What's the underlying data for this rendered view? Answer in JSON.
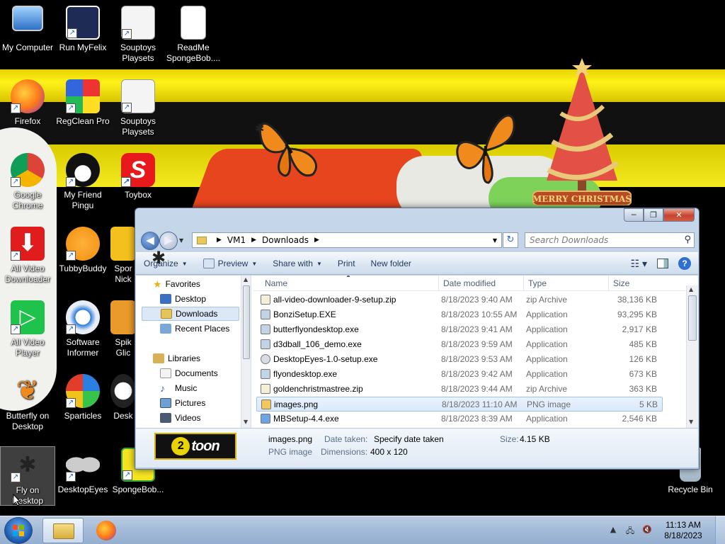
{
  "desktop": {
    "icons": [
      {
        "label": "My Computer"
      },
      {
        "label": "Run MyFelix"
      },
      {
        "label": "Souptoys Playsets"
      },
      {
        "label": "ReadMe SpongeBob...."
      },
      {
        "label": "Firefox"
      },
      {
        "label": "RegClean Pro"
      },
      {
        "label": "Souptoys Playsets"
      },
      {
        "label": "Google Chrome"
      },
      {
        "label": "My Friend Pingu"
      },
      {
        "label": "Toybox"
      },
      {
        "label": "All Video Downloader"
      },
      {
        "label": "TubbyBuddy"
      },
      {
        "label": "Spor Nick"
      },
      {
        "label": "All Video Player"
      },
      {
        "label": "Software Informer"
      },
      {
        "label": "Spik Glic"
      },
      {
        "label": "Butterfly on Desktop"
      },
      {
        "label": "Sparticles"
      },
      {
        "label": "Desk"
      },
      {
        "label": "Fly on Desktop"
      },
      {
        "label": "DesktopEyes"
      },
      {
        "label": "SpongeBob..."
      },
      {
        "label": "Recycle Bin"
      }
    ],
    "tree_banner": "MERRY CHRISTMAS"
  },
  "explorer": {
    "caption": {
      "minimize": "─",
      "maximize": "❐",
      "close": "✕"
    },
    "address": {
      "root": "VM1",
      "folder": "Downloads",
      "sep": "▶"
    },
    "search_placeholder": "Search Downloads",
    "commands": {
      "organize": "Organize",
      "preview": "Preview",
      "share": "Share with",
      "print": "Print",
      "new_folder": "New folder"
    },
    "nav": {
      "favorites": "Favorites",
      "desktop": "Desktop",
      "downloads": "Downloads",
      "recent": "Recent Places",
      "libraries": "Libraries",
      "documents": "Documents",
      "music": "Music",
      "pictures": "Pictures",
      "videos": "Videos"
    },
    "columns": {
      "name": "Name",
      "date": "Date modified",
      "type": "Type",
      "size": "Size"
    },
    "files": [
      {
        "name": "all-video-downloader-9-setup.zip",
        "date": "8/18/2023 9:40 AM",
        "type": "zip Archive",
        "size": "38,136 KB"
      },
      {
        "name": "BonziSetup.EXE",
        "date": "8/18/2023 10:55 AM",
        "type": "Application",
        "size": "93,295 KB"
      },
      {
        "name": "butterflyondesktop.exe",
        "date": "8/18/2023 9:41 AM",
        "type": "Application",
        "size": "2,917 KB"
      },
      {
        "name": "d3dball_106_demo.exe",
        "date": "8/18/2023 9:59 AM",
        "type": "Application",
        "size": "485 KB"
      },
      {
        "name": "DesktopEyes-1.0-setup.exe",
        "date": "8/18/2023 9:53 AM",
        "type": "Application",
        "size": "126 KB"
      },
      {
        "name": "flyondesktop.exe",
        "date": "8/18/2023 9:42 AM",
        "type": "Application",
        "size": "673 KB"
      },
      {
        "name": "goldenchristmastree.zip",
        "date": "8/18/2023 9:44 AM",
        "type": "zip Archive",
        "size": "363 KB"
      },
      {
        "name": "images.png",
        "date": "8/18/2023 11:10 AM",
        "type": "PNG image",
        "size": "5 KB"
      },
      {
        "name": "MBSetup-4.4.exe",
        "date": "8/18/2023 8:39 AM",
        "type": "Application",
        "size": "2,546 KB"
      }
    ],
    "details": {
      "filename": "images.png",
      "filetype": "PNG image",
      "date_taken_label": "Date taken:",
      "date_taken_value": "Specify date taken",
      "dimensions_label": "Dimensions:",
      "dimensions_value": "400 x 120",
      "size_label": "Size:",
      "size_value": "4.15 KB",
      "thumb_badge": "2",
      "thumb_word": "toon"
    }
  },
  "taskbar": {
    "time": "11:13 AM",
    "date": "8/18/2023"
  }
}
